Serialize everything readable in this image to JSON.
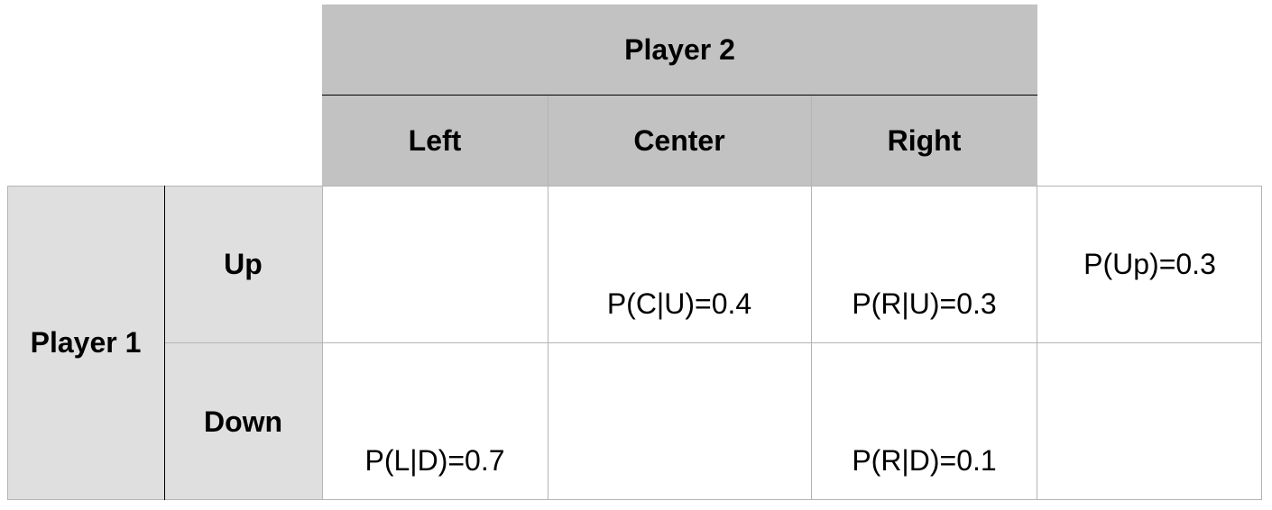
{
  "header": {
    "column_player": "Player 2",
    "columns": [
      "Left",
      "Center",
      "Right"
    ]
  },
  "row_player": {
    "label": "Player 1",
    "rows": [
      "Up",
      "Down"
    ]
  },
  "cells": {
    "up": [
      "",
      "P(C|U)=0.4",
      "P(R|U)=0.3"
    ],
    "down": [
      "P(L|D)=0.7",
      "",
      "P(R|D)=0.1"
    ]
  },
  "marginals": {
    "up": "P(Up)=0.3",
    "down": ""
  },
  "colors": {
    "header_dark": "#c1c2c1",
    "header_light": "#dfdfdf",
    "grid_line": "#b4b4b4",
    "strong_line": "#000000"
  }
}
